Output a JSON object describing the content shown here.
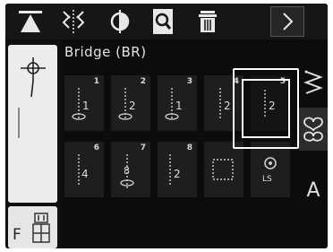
{
  "toolbar": {
    "buttons": [
      {
        "icon": "needle-stop-position-icon"
      },
      {
        "icon": "mirror-image-icon"
      },
      {
        "icon": "balance-icon"
      },
      {
        "icon": "zoom-preview-icon"
      },
      {
        "icon": "delete-icon"
      },
      {
        "icon": "next-arrow-icon"
      }
    ]
  },
  "stitch": {
    "title": "Bridge (BR)",
    "cells": [
      {
        "num": "1",
        "glyph": "1"
      },
      {
        "num": "2",
        "glyph": "2"
      },
      {
        "num": "3",
        "glyph": "1"
      },
      {
        "num": "4",
        "glyph": "2"
      },
      {
        "num": "5",
        "glyph": "2"
      },
      {
        "num": "6",
        "glyph": "4"
      },
      {
        "num": "7",
        "glyph": "8"
      },
      {
        "num": "8",
        "glyph": "2"
      },
      {
        "num": "",
        "glyph": ""
      },
      {
        "num": "",
        "glyph": "LS"
      }
    ],
    "selected": 4
  },
  "foot": {
    "label": "F"
  },
  "right": {
    "alpha_label": "A"
  },
  "colors": {
    "background": "#0c0c0c",
    "panel": "#ececec",
    "cell": "#1e1e1e",
    "selection": "#ffffff"
  }
}
